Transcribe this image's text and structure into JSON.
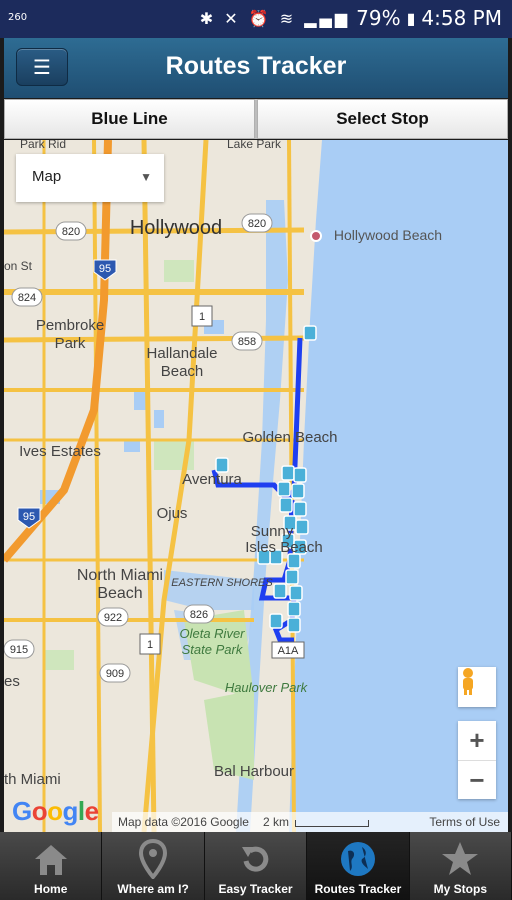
{
  "status_bar": {
    "left_text": "260",
    "battery": "79%",
    "time": "4:58 PM",
    "icons": [
      "bluetooth-icon",
      "mute-icon",
      "alarm-icon",
      "wifi-icon",
      "signal-icon",
      "battery-icon"
    ]
  },
  "app_bar": {
    "title": "Routes Tracker",
    "menu_icon": "list-icon"
  },
  "tabs": {
    "route": "Blue Line",
    "stop": "Select Stop"
  },
  "map": {
    "map_type": "Map",
    "labels": {
      "park_ridge": "Park Rid",
      "lake_park": "Lake Park",
      "hollywood": "Hollywood",
      "hollywood_beach": "Hollywood Beach",
      "pembroke_park": "Pembroke\nPark",
      "hallandale_beach": "Hallandale\nBeach",
      "golden_beach": "Golden Beach",
      "ives_estates": "Ives Estates",
      "aventura": "Aventura",
      "ojus": "Ojus",
      "sunny_isles": "Sunny\nIsles Beach",
      "north_miami_beach": "North Miami\nBeach",
      "eastern_shores": "EASTERN SHORES",
      "oleta": "Oleta River\nState Park",
      "haulover": "Haulover Park",
      "bal_harbour": "Bal Harbour",
      "miami": "th Miami",
      "on_st": "on St",
      "es": "es",
      "hw_820a": "820",
      "hw_820b": "820",
      "hw_824": "824",
      "hw_858": "858",
      "hw_826": "826",
      "hw_915": "915",
      "hw_909": "909",
      "hw_922": "922",
      "i_95a": "95",
      "i_95b": "95",
      "us_1a": "1",
      "us_1b": "1",
      "a1a": "A1A"
    },
    "google": "Google",
    "attribution": "Map data ©2016 Google",
    "scale": "2 km",
    "terms": "Terms of Use"
  },
  "bottom_nav": [
    {
      "label": "Home",
      "icon": "home-icon",
      "active": false
    },
    {
      "label": "Where am I?",
      "icon": "location-pin-icon",
      "active": false
    },
    {
      "label": "Easy Tracker",
      "icon": "refresh-icon",
      "active": false
    },
    {
      "label": "Routes Tracker",
      "icon": "globe-icon",
      "active": true
    },
    {
      "label": "My Stops",
      "icon": "star-icon",
      "active": false
    }
  ],
  "colors": {
    "route_line": "#1f3ff0",
    "water": "#a9cdf5",
    "highway": "#f5c243",
    "app_bar": "#2a5f86"
  }
}
